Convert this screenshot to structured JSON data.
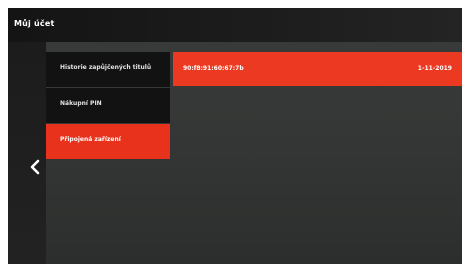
{
  "header": {
    "title": "Můj účet"
  },
  "navigation": {
    "back_icon": "chevron-left-icon"
  },
  "menu": {
    "items": [
      {
        "label": "Historie zapůjčených titulů",
        "selected": false
      },
      {
        "label": "Nákupní PIN",
        "selected": false
      },
      {
        "label": "Připojená zařízení",
        "selected": true
      }
    ]
  },
  "devices": [
    {
      "id": "90:f8:91:60:67:7b",
      "date": "1-11-2019"
    }
  ],
  "colors": {
    "accent": "#e8321c",
    "background": "#343635",
    "menu_background": "#121212",
    "text": "#ffffff"
  }
}
